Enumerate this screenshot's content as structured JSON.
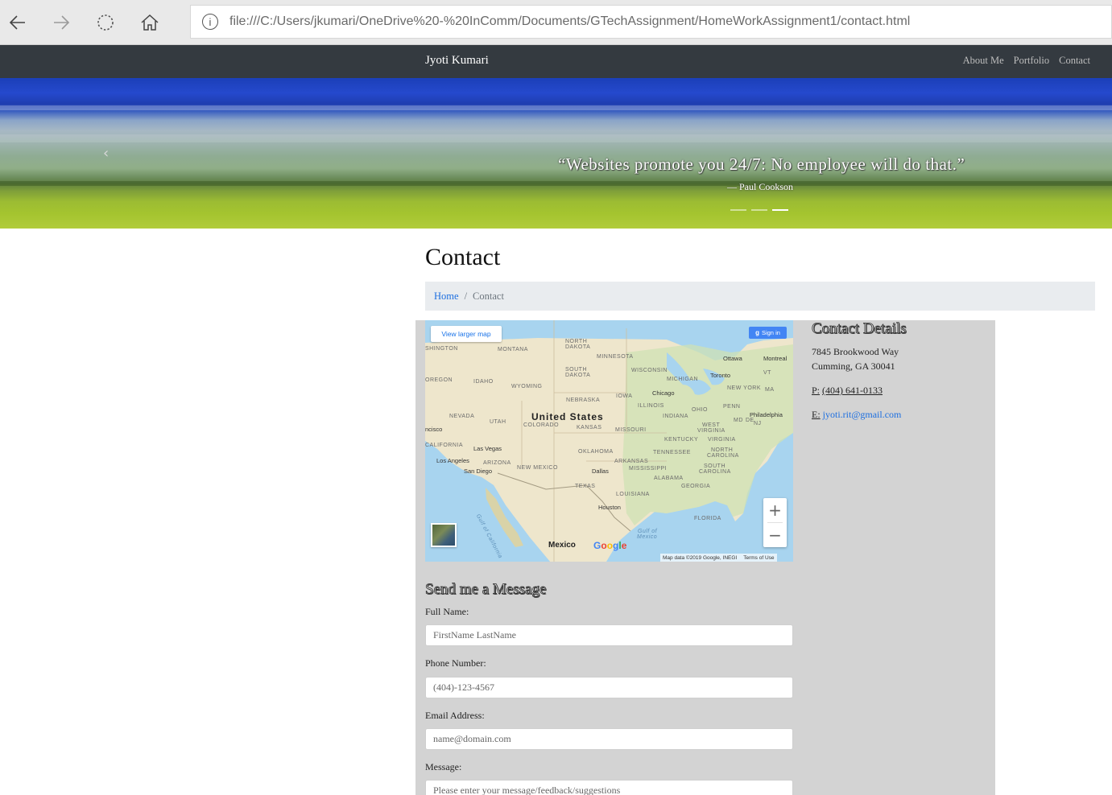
{
  "browser": {
    "url": "file:///C:/Users/jkumari/OneDrive%20-%20InComm/Documents/GTechAssignment/HomeWorkAssignment1/contact.html",
    "info_icon": "i"
  },
  "navbar": {
    "brand": "Jyoti Kumari",
    "links": [
      "About Me",
      "Portfolio",
      "Contact"
    ]
  },
  "hero": {
    "prev_icon": "‹",
    "quote": "“Websites promote you 24/7: No employee will do that.”",
    "author": "— Paul Cookson",
    "indicator_count": 3,
    "active_indicator": 2
  },
  "page": {
    "title": "Contact",
    "breadcrumb": {
      "home": "Home",
      "separator": "/",
      "current": "Contact"
    }
  },
  "map": {
    "view_larger": "View larger map",
    "sign_in": "Sign in",
    "zoom_in": "+",
    "zoom_out": "−",
    "google": [
      "G",
      "o",
      "o",
      "g",
      "l",
      "e"
    ],
    "attribution": "Map data ©2019 Google, INEGI",
    "terms": "Terms of Use",
    "labels": {
      "washington": "SHINGTON",
      "montana": "MONTANA",
      "north_dakota_1": "NORTH",
      "north_dakota_2": "DAKOTA",
      "minnesota": "MINNESOTA",
      "ottawa": "Ottawa",
      "montreal": "Montreal",
      "oregon": "OREGON",
      "idaho": "IDAHO",
      "south_dakota_1": "SOUTH",
      "south_dakota_2": "DAKOTA",
      "wisconsin": "WISCONSIN",
      "michigan": "MICHIGAN",
      "toronto": "Toronto",
      "vt": "VT",
      "new_york": "NEW YORK",
      "ma": "MA",
      "wyoming": "WYOMING",
      "chicago": "Chicago",
      "nebraska": "NEBRASKA",
      "iowa": "IOWA",
      "penn": "PENN",
      "illinois": "ILLINOIS",
      "ohio": "OHIO",
      "nevada": "NEVADA",
      "utah": "UTAH",
      "united_states": "United States",
      "indiana": "INDIANA",
      "philadelphia": "Philadelphia",
      "francisco": "ncisco",
      "colorado": "COLORADO",
      "kansas": "KANSAS",
      "missouri": "MISSOURI",
      "west_virginia_1": "WEST",
      "west_virginia_2": "VIRGINIA",
      "md": "MD",
      "de": "DE",
      "nj": "NJ",
      "california": "CALIFORNIA",
      "las_vegas": "Las Vegas",
      "kentucky": "KENTUCKY",
      "virginia": "VIRGINIA",
      "north_carolina_1": "NORTH",
      "north_carolina_2": "CAROLINA",
      "los_angeles": "Los Angeles",
      "oklahoma": "OKLAHOMA",
      "tennessee": "TENNESSEE",
      "arizona": "ARIZONA",
      "arkansas": "ARKANSAS",
      "san_diego": "San Diego",
      "new_mexico": "NEW MEXICO",
      "mississippi": "MISSISSIPPI",
      "south_carolina_1": "SOUTH",
      "south_carolina_2": "CAROLINA",
      "dallas": "Dallas",
      "alabama": "ALABAMA",
      "georgia": "GEORGIA",
      "texas": "TEXAS",
      "louisiana": "LOUISIANA",
      "houston": "Houston",
      "florida": "FLORIDA",
      "gulf_california": "Gulf of California",
      "gulf_mexico_1": "Gulf of",
      "gulf_mexico_2": "Mexico",
      "mexico": "Mexico"
    }
  },
  "contact_details": {
    "heading": "Contact Details",
    "address_line1": "7845 Brookwood Way",
    "address_line2": "Cumming, GA 30041",
    "phone_prefix": "P:",
    "phone": "(404) 641-0133",
    "email_prefix": "E:",
    "email": "jyoti.rit@gmail.com"
  },
  "form": {
    "heading": "Send me a Message",
    "name_label": "Full Name:",
    "name_placeholder": "FirstName LastName",
    "phone_label": "Phone Number:",
    "phone_placeholder": "(404)-123-4567",
    "email_label": "Email Address:",
    "email_placeholder": "name@domain.com",
    "message_label": "Message:",
    "message_placeholder": "Please enter your message/feedback/suggestions"
  },
  "colors": {
    "navbar_bg": "#343a40",
    "link_blue": "#1d6fe0",
    "panel_bg": "#d3d3d3",
    "breadcrumb_bg": "#e9ecef"
  }
}
